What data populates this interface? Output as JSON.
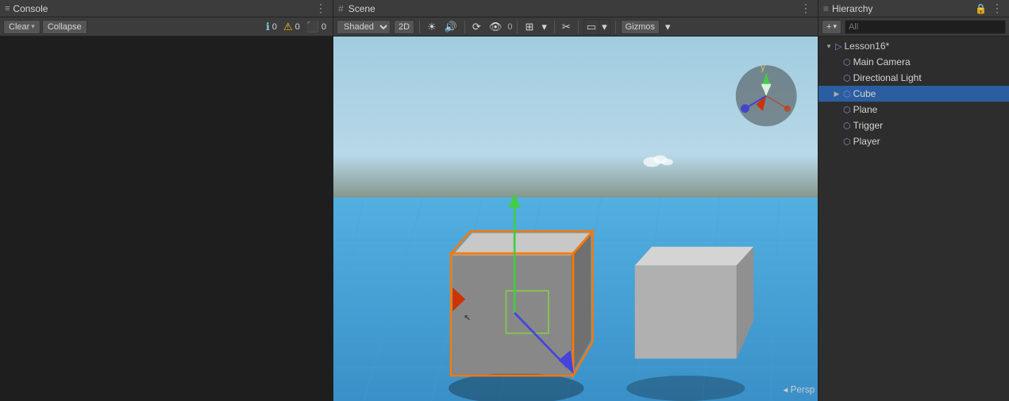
{
  "console": {
    "title": "Console",
    "title_icon": "≡",
    "clear_label": "Clear",
    "collapse_label": "Collapse",
    "badges": [
      {
        "icon": "ℹ",
        "count": "0",
        "type": "info"
      },
      {
        "icon": "⚠",
        "count": "0",
        "type": "warn"
      },
      {
        "icon": "⬛",
        "count": "0",
        "type": "error"
      }
    ],
    "options_icon": "⋮"
  },
  "scene": {
    "title": "Scene",
    "title_icon": "#",
    "options_icon": "⋮",
    "shading_label": "Shaded",
    "view_2d_label": "2D",
    "gizmos_label": "Gizmos",
    "persp_label": "◂ Persp"
  },
  "hierarchy": {
    "title": "Hierarchy",
    "title_icon": "≡",
    "options_icon": "⋮",
    "lock_icon": "🔒",
    "add_label": "+",
    "search_placeholder": "All",
    "items": [
      {
        "label": "Lesson16*",
        "level": 0,
        "has_arrow": true,
        "expanded": true,
        "icon": "scene",
        "selected": false
      },
      {
        "label": "Main Camera",
        "level": 1,
        "has_arrow": false,
        "expanded": false,
        "icon": "camera",
        "selected": false
      },
      {
        "label": "Directional Light",
        "level": 1,
        "has_arrow": false,
        "expanded": false,
        "icon": "light",
        "selected": false
      },
      {
        "label": "Cube",
        "level": 1,
        "has_arrow": true,
        "expanded": false,
        "icon": "cube",
        "selected": true
      },
      {
        "label": "Plane",
        "level": 1,
        "has_arrow": false,
        "expanded": false,
        "icon": "cube",
        "selected": false
      },
      {
        "label": "Trigger",
        "level": 1,
        "has_arrow": false,
        "expanded": false,
        "icon": "cube",
        "selected": false
      },
      {
        "label": "Player",
        "level": 1,
        "has_arrow": false,
        "expanded": false,
        "icon": "cube",
        "selected": false
      }
    ]
  }
}
